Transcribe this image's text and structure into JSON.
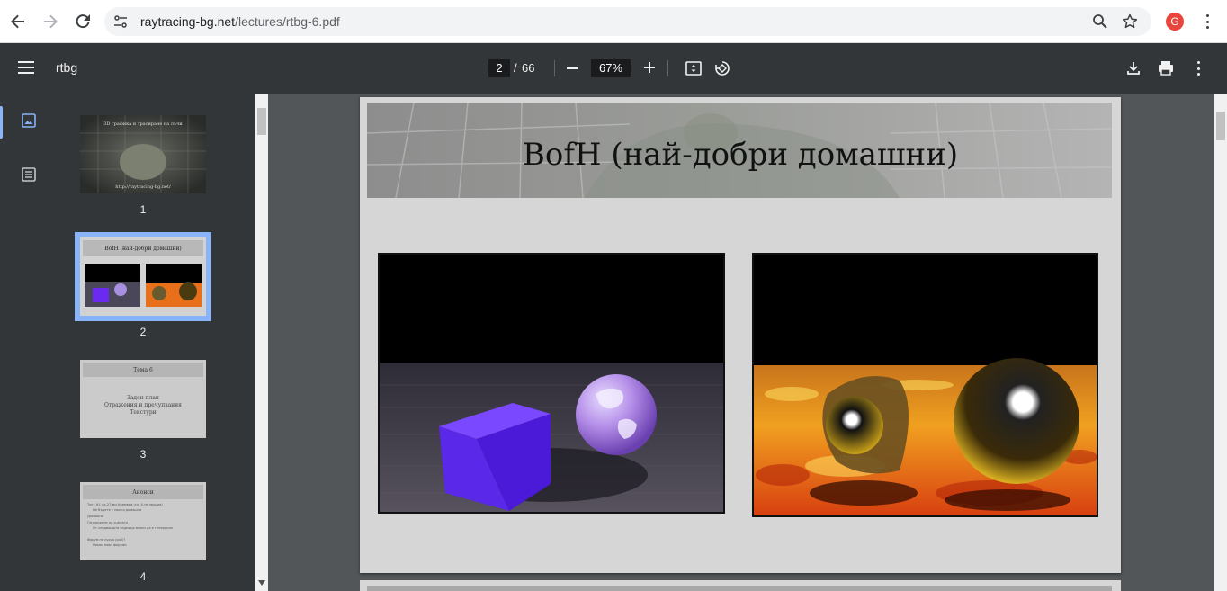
{
  "browser": {
    "url_host": "raytracing-bg.net",
    "url_path": "/lectures/rtbg-6.pdf",
    "profile_initial": "G"
  },
  "toolbar": {
    "doc_title": "rtbg",
    "current_page": "2",
    "page_separator": "/",
    "total_pages": "66",
    "zoom": "67%"
  },
  "thumbnails": [
    {
      "number": "1",
      "title": "3D графика и трасиране на лъчи",
      "url": "http://raytracing-bg.net/"
    },
    {
      "number": "2",
      "title": "BofH (най-добри домашни)"
    },
    {
      "number": "3",
      "title": "Тема 6",
      "lines": [
        "Заден план",
        "Отражения и пречупвания",
        "Текстури"
      ]
    },
    {
      "number": "4",
      "title": "Анонси",
      "lines": [
        "Тест #1 на 27-ми Ноември (сл. 4-те лекции)",
        "Не бъдете с малко домашни",
        "Домашни",
        "Генериране на сцената",
        "От следващата седмица всеки да е генериран",
        "Форум на курса (poll)?",
        "Някои нови форуми"
      ]
    }
  ],
  "slide": {
    "title": "BofH (най-добри домашни)"
  },
  "colors": {
    "toolbar_bg": "#323639",
    "viewer_bg": "#525659",
    "accent": "#8ab4f8"
  }
}
